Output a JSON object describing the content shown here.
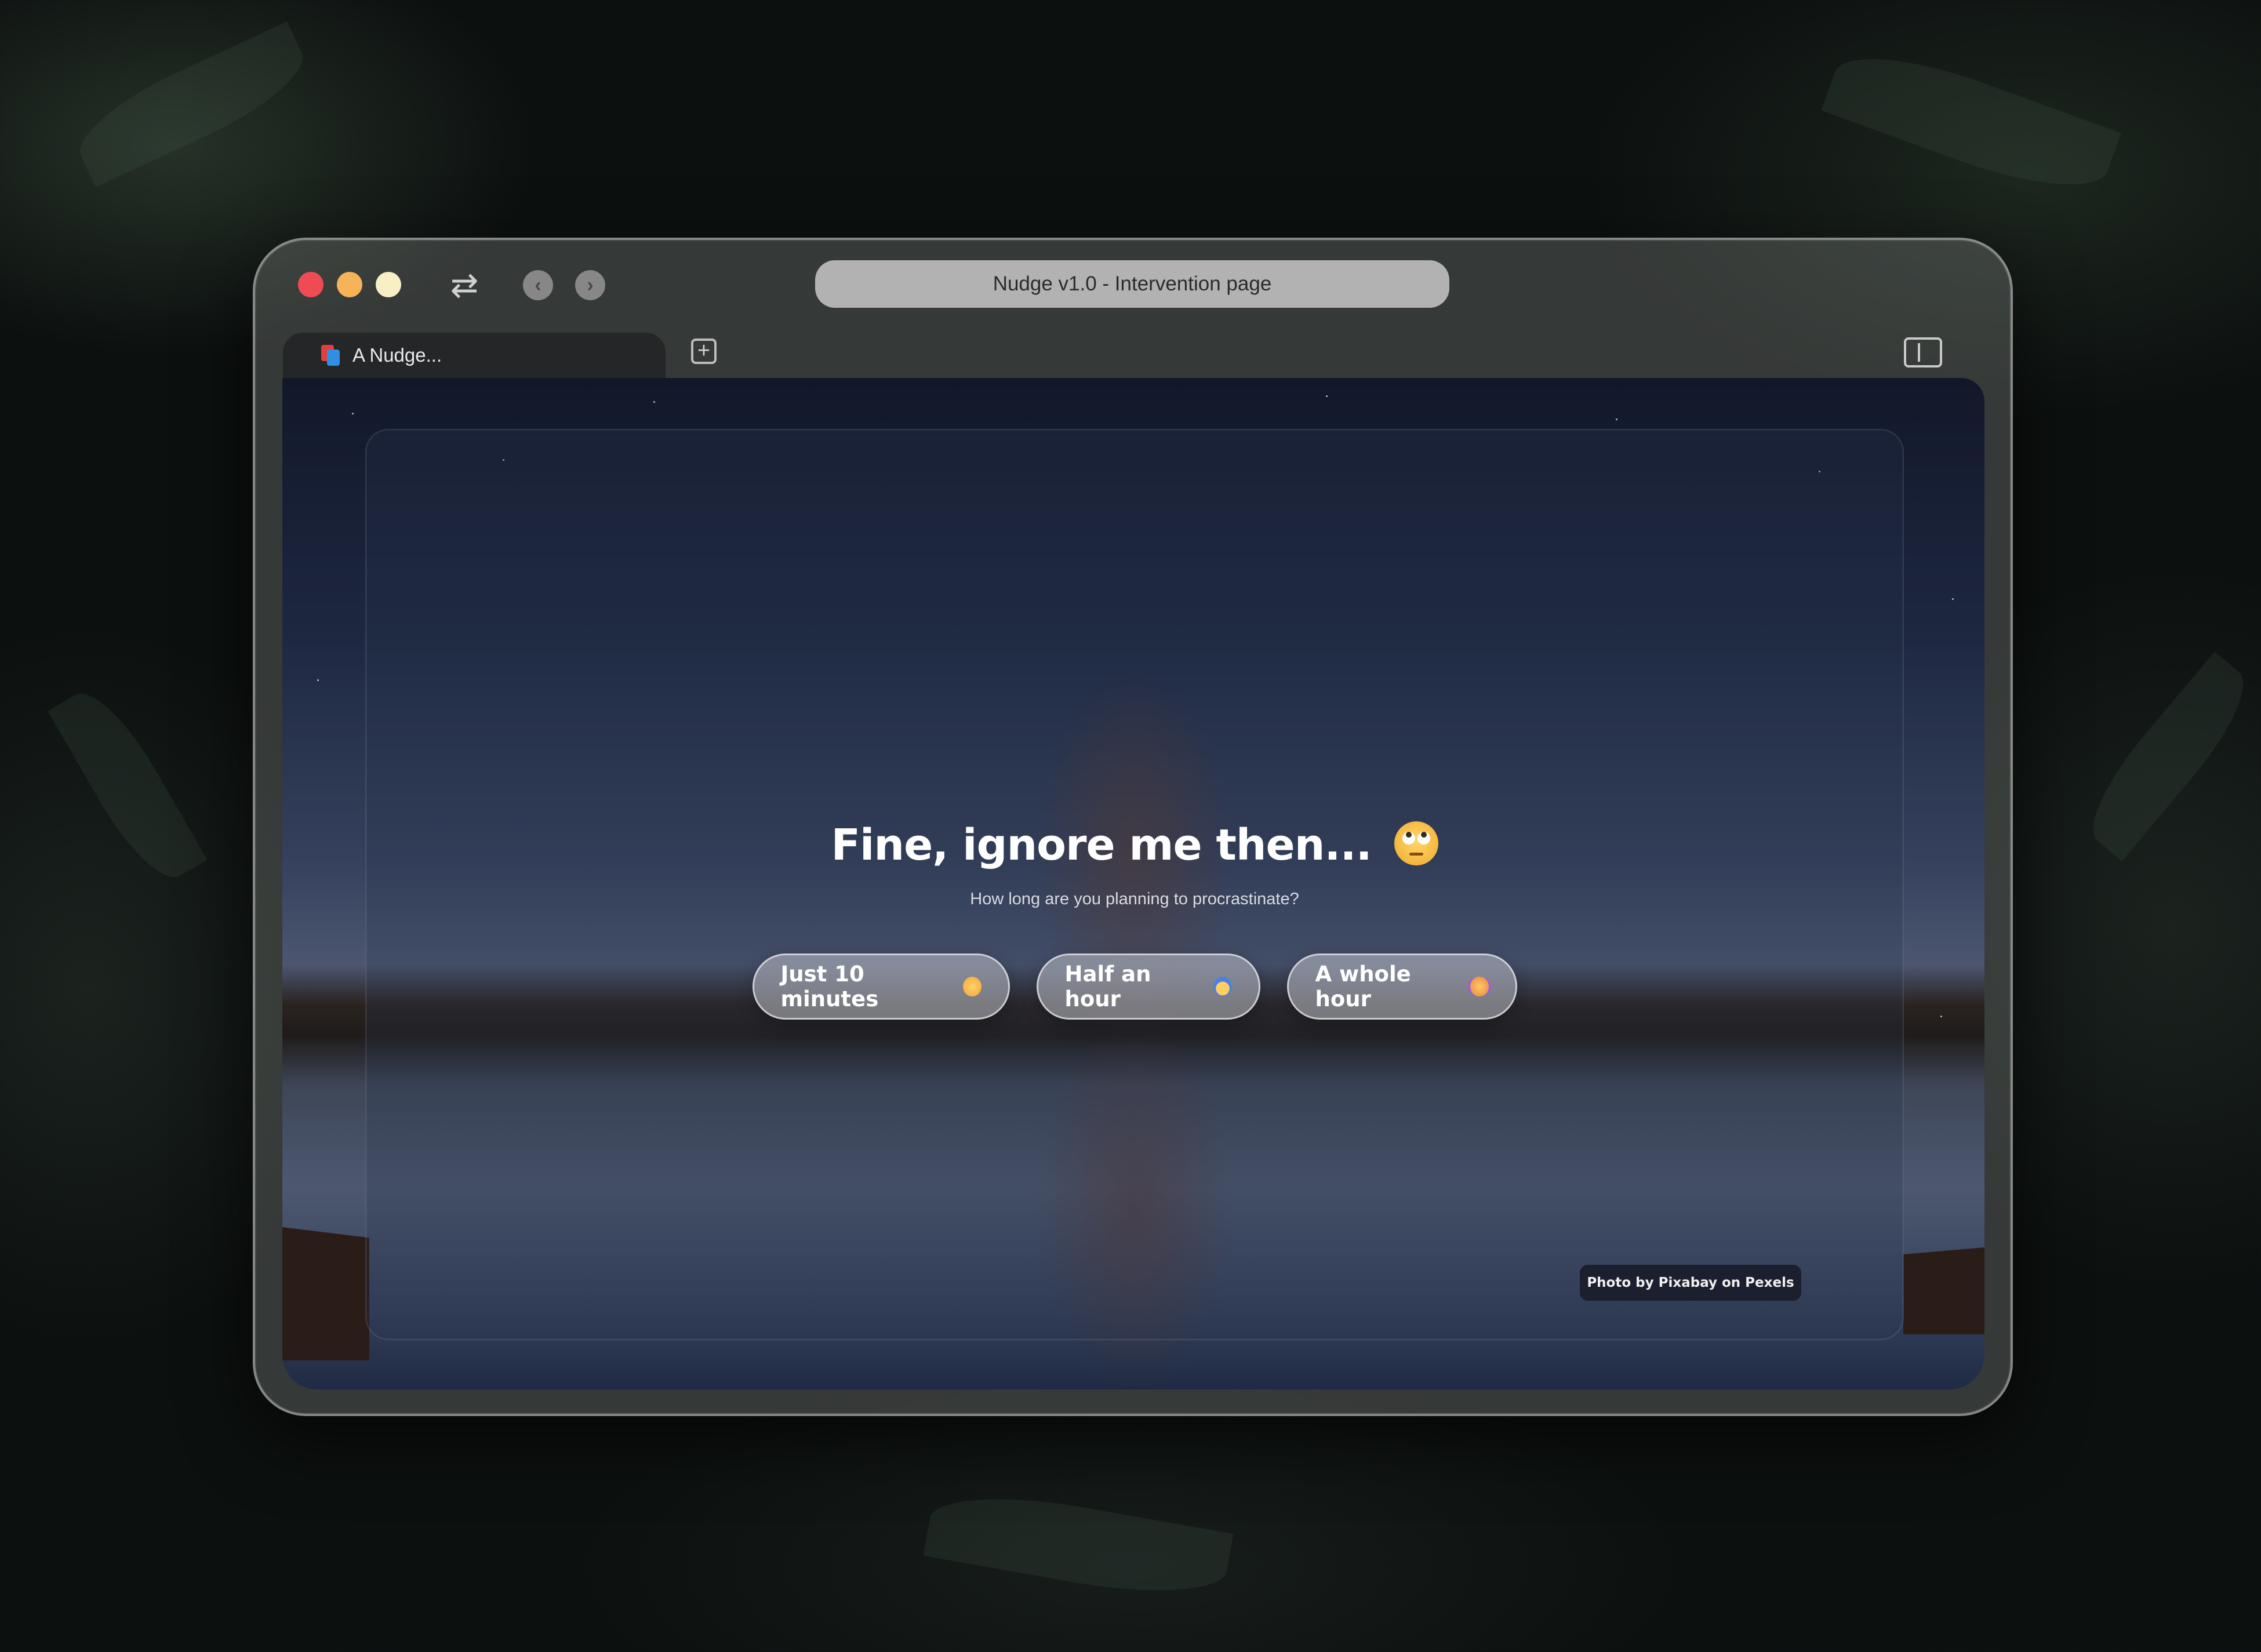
{
  "window": {
    "address_title": "Nudge v1.0 - Intervention page",
    "tab_label": "A Nudge..."
  },
  "toolbar": {
    "icons": [
      "close-dot",
      "minimize-dot",
      "maximize-dot",
      "refresh-icon",
      "back-icon",
      "forward-icon",
      "new-tab-icon",
      "sidebar-toggle-icon"
    ]
  },
  "page": {
    "headline": "Fine, ignore me then...",
    "headline_emoji": "face-with-rolling-eyes",
    "subtitle": "How long are you planning to procrastinate?",
    "options": [
      {
        "label": "Just 10 minutes",
        "emoji": "flushed-face"
      },
      {
        "label": "Half an hour",
        "emoji": "face-screaming-in-fear"
      },
      {
        "label": "A whole hour",
        "emoji": "crying-face"
      }
    ],
    "credit": "Photo by Pixabay on Pexels"
  },
  "colors": {
    "traffic_red": "#f04b55",
    "traffic_yellow": "#f6b35a",
    "traffic_green": "#f8efc6",
    "credit_bg": "#1b1f2e"
  }
}
